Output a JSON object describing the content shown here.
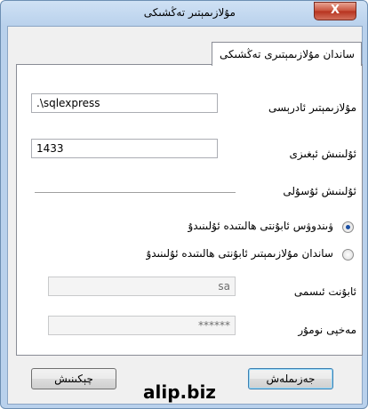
{
  "window": {
    "title": "مۇلازىمېتىر تەڭشىكى",
    "close_glyph": "X"
  },
  "tab": {
    "label": "ساندان مۇلازىمېتىرى تەڭشىكى"
  },
  "form": {
    "server_address_label": "مۇلازىمېتىر ئادرېسى",
    "server_address_value": ".\\sqlexpress",
    "port_label": "ئۇلىنىش ئېغىزى",
    "port_value": "1433",
    "connection_mode_label": "ئۇلىنىش ئۇسۇلى",
    "radio_windows_label": "ۋىندوۋس ئابۇنتى ھالىتىدە ئۇلىنىدۇ",
    "radio_windows_checked": true,
    "radio_server_label": "ساندان مۇلازىمېتىر ئابۇنتى ھالىتىدە ئۇلىنىدۇ",
    "radio_server_checked": false,
    "username_label": "ئابۇنت ئىسمى",
    "username_value": "sa",
    "password_label": "مەخپى نومۇر",
    "password_value": "******"
  },
  "buttons": {
    "test_label": "چېكىنىش",
    "ok_label": "جەزىملەش"
  },
  "watermark": "alip.biz"
}
